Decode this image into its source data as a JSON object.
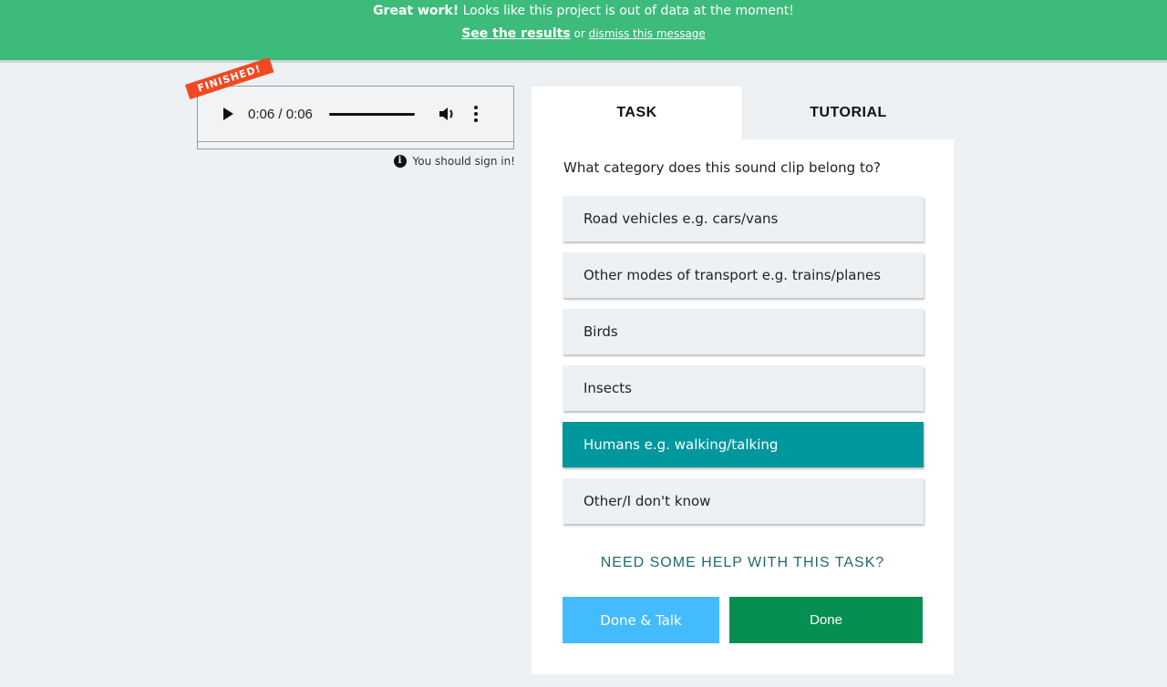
{
  "banner": {
    "strong": "Great work!",
    "message": " Looks like this project is out of data at the moment!",
    "results_link": "See the results",
    "or_text": " or ",
    "dismiss_link": "dismiss this message",
    "color": "#3dbb7a"
  },
  "audio": {
    "badge": "FINISHED!",
    "time": "0:06 / 0:06",
    "play_icon": "play-icon",
    "volume_icon": "volume-icon",
    "more_icon": "more-options-icon"
  },
  "signin": {
    "icon": "info-icon",
    "icon_glyph": "i",
    "text": "You should sign in!"
  },
  "tabs": {
    "task": "TASK",
    "tutorial": "TUTORIAL"
  },
  "task": {
    "question": "What category does this sound clip belong to?",
    "answers": [
      {
        "label": "Road vehicles e.g. cars/vans",
        "selected": false
      },
      {
        "label": "Other modes of transport e.g. trains/planes",
        "selected": false
      },
      {
        "label": "Birds",
        "selected": false
      },
      {
        "label": "Insects",
        "selected": false
      },
      {
        "label": "Humans e.g. walking/talking",
        "selected": true
      },
      {
        "label": "Other/I don't know",
        "selected": false
      }
    ],
    "selected_color": "#00979d",
    "help": "NEED SOME HELP WITH THIS TASK?"
  },
  "buttons": {
    "done_talk": "Done & Talk",
    "done": "Done",
    "done_talk_color": "#43bbfd",
    "done_color": "#078f52"
  }
}
